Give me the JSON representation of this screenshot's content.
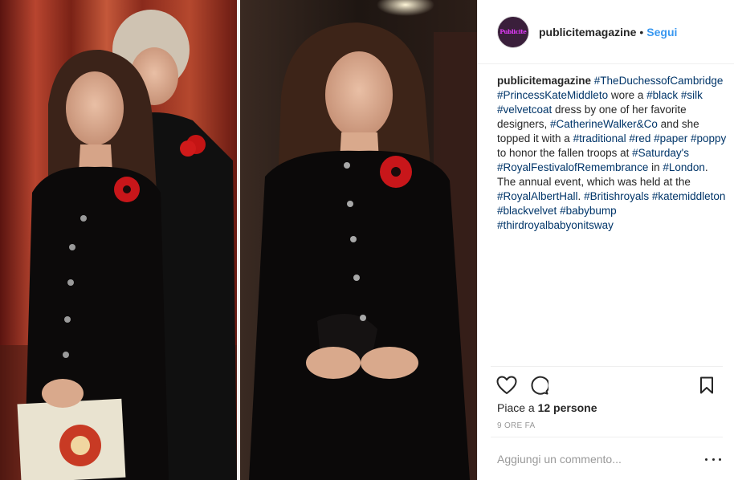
{
  "post": {
    "username": "publicitemagazine",
    "separator": "•",
    "follow_label": "Segui",
    "avatar_text": "Publicite",
    "caption_segments": [
      {
        "t": "publicitemagazine",
        "k": "user"
      },
      {
        "t": " ",
        "k": "text"
      },
      {
        "t": "#TheDuchessofCambridge",
        "k": "tag"
      },
      {
        "t": " ",
        "k": "text"
      },
      {
        "t": "#PrincessKateMiddleto",
        "k": "tag"
      },
      {
        "t": " wore a ",
        "k": "text"
      },
      {
        "t": "#black",
        "k": "tag"
      },
      {
        "t": " ",
        "k": "text"
      },
      {
        "t": "#silk",
        "k": "tag"
      },
      {
        "t": " ",
        "k": "text"
      },
      {
        "t": "#velvetcoat",
        "k": "tag"
      },
      {
        "t": " dress by one of her favorite designers, ",
        "k": "text"
      },
      {
        "t": "#CatherineWalker&Co",
        "k": "tag"
      },
      {
        "t": " and she topped it with a ",
        "k": "text"
      },
      {
        "t": "#traditional",
        "k": "tag"
      },
      {
        "t": " ",
        "k": "text"
      },
      {
        "t": "#red",
        "k": "tag"
      },
      {
        "t": " ",
        "k": "text"
      },
      {
        "t": "#paper",
        "k": "tag"
      },
      {
        "t": " ",
        "k": "text"
      },
      {
        "t": "#poppy",
        "k": "tag"
      },
      {
        "t": " to honor the fallen troops at ",
        "k": "text"
      },
      {
        "t": "#Saturday's",
        "k": "tag"
      },
      {
        "t": " ",
        "k": "text"
      },
      {
        "t": "#RoyalFestivalofRemembrance",
        "k": "tag"
      },
      {
        "t": " in ",
        "k": "text"
      },
      {
        "t": "#London",
        "k": "tag"
      },
      {
        "t": ". The annual event, which was held at the ",
        "k": "text"
      },
      {
        "t": "#RoyalAlbertHall",
        "k": "tag"
      },
      {
        "t": ". ",
        "k": "text"
      },
      {
        "t": "#Britishroyals",
        "k": "tag"
      },
      {
        "t": " ",
        "k": "text"
      },
      {
        "t": "#katemiddleton",
        "k": "tag"
      },
      {
        "t": " ",
        "k": "text"
      },
      {
        "t": "#blackvelvet",
        "k": "tag"
      },
      {
        "t": " ",
        "k": "text"
      },
      {
        "t": "#babybump",
        "k": "tag"
      },
      {
        "t": " ",
        "k": "text"
      },
      {
        "t": "#thirdroyalbabyonitsway",
        "k": "tag"
      }
    ],
    "likes_prefix": "Piace a ",
    "likes_count": "12 persone",
    "timestamp": "9 ORE FA",
    "comment_placeholder": "Aggiungi un commento...",
    "icons": {
      "like": "heart-icon",
      "comment": "comment-icon",
      "save": "bookmark-icon",
      "more": "more-options-icon"
    },
    "colors": {
      "link": "#3897f0",
      "hashtag": "#003569",
      "text": "#262626",
      "muted": "#999999",
      "border": "#efefef"
    }
  }
}
